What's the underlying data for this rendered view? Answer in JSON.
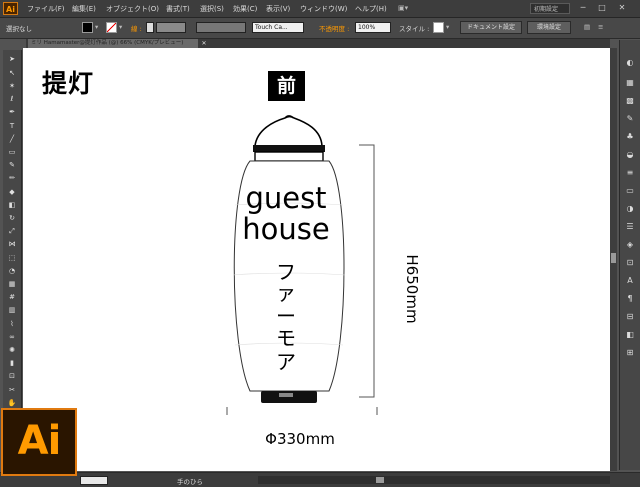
{
  "app": {
    "logo_text": "Ai",
    "big_logo_text": "Ai",
    "accent": "#ff9a00"
  },
  "menu": {
    "items": [
      "ファイル(F)",
      "編集(E)",
      "オブジェクト(O)",
      "書式(T)",
      "選択(S)",
      "効果(C)",
      "表示(V)",
      "ウィンドウ(W)",
      "ヘルプ(H)"
    ],
    "workspace": "初期設定",
    "window_buttons": [
      "─",
      "□",
      "✕"
    ]
  },
  "control": {
    "selection": "選択なし",
    "stroke_label": "線 :",
    "brush_name": "Touch Ca...",
    "opacity_label": "不透明度 :",
    "opacity_value": "100%",
    "style_label": "スタイル :",
    "doc_setup": "ドキュメント設定",
    "prefs": "環境設定"
  },
  "document": {
    "tab_title": "ミリ Hamamaster@提灯作品 (@) 66% (CMYK/プレビュー)",
    "tab_close": "✕"
  },
  "artboard": {
    "heading": "提灯",
    "front_label": "前",
    "line1": "guest",
    "line2": "house",
    "kana": [
      "フ",
      "ァ",
      "ー",
      "モ",
      "ア"
    ],
    "height_label": "H650mm",
    "width_label": "Φ330mm"
  },
  "status": {
    "tool_name": "手のひら"
  },
  "tools": {
    "left": [
      "selection-tool",
      "direct-selection-tool",
      "magic-wand-tool",
      "lasso-tool",
      "pen-tool",
      "type-tool",
      "line-tool",
      "rectangle-tool",
      "paintbrush-tool",
      "pencil-tool",
      "blob-brush-tool",
      "eraser-tool",
      "rotate-tool",
      "scale-tool",
      "width-tool",
      "free-transform-tool",
      "shape-builder-tool",
      "perspective-grid-tool",
      "mesh-tool",
      "gradient-tool",
      "eyedropper-tool",
      "blend-tool",
      "symbol-sprayer-tool",
      "column-graph-tool",
      "artboard-tool",
      "slice-tool",
      "hand-tool",
      "zoom-tool"
    ],
    "right": [
      "color-panel",
      "color-guide-panel",
      "swatches-panel",
      "brushes-panel",
      "symbols-panel",
      "graphic-styles-panel",
      "stroke-panel",
      "gradient-panel",
      "transparency-panel",
      "appearance-panel",
      "layers-panel",
      "artboards-panel",
      "character-panel",
      "paragraph-panel",
      "align-panel",
      "pathfinder-panel",
      "transform-panel"
    ]
  }
}
